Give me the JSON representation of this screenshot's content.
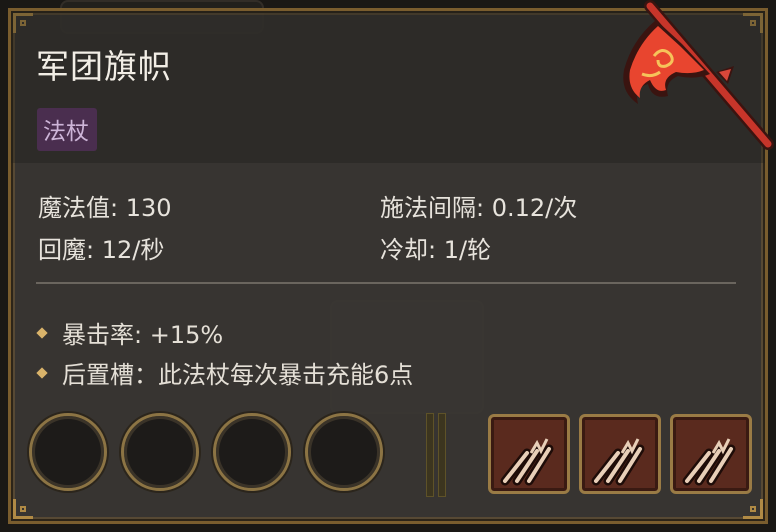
{
  "item": {
    "name": "军团旗帜",
    "type_tag": "法杖"
  },
  "stats": {
    "mana": "魔法值: 130",
    "cast_interval": "施法间隔: 0.12/次",
    "regen": "回魔: 12/秒",
    "cooldown": "冷却: 1/轮"
  },
  "effects": [
    "暴击率: +15%",
    "后置槽：此法杖每次暴击充能6点"
  ],
  "slots": {
    "empty_count": 4,
    "spell_cards": [
      "claw-slash-icon",
      "claw-slash-icon",
      "claw-slash-icon"
    ]
  },
  "colors": {
    "panel_border": "#7a5d2e",
    "tag_bg": "#4a2e4f",
    "bullet": "#d9b36a",
    "card_bg": "#5a2a1e",
    "flag_red": "#e8452f"
  }
}
